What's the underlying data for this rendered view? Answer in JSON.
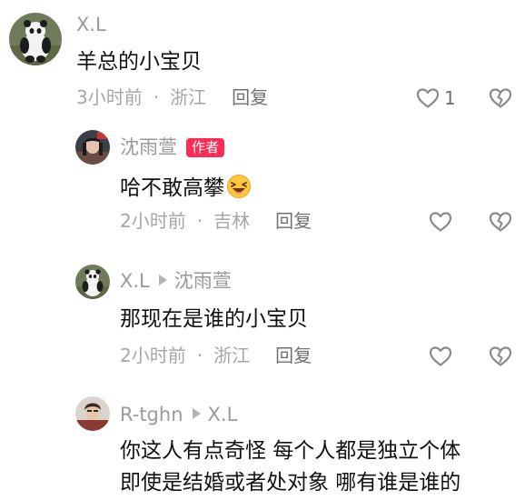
{
  "comments": [
    {
      "username": "X.L",
      "text": "羊总的小宝贝",
      "time": "3小时前",
      "location": "浙江",
      "reply_label": "回复",
      "likes": "1"
    },
    {
      "username": "沈雨萱",
      "badge": "作者",
      "text": "哈不敢高攀",
      "emoji": "grinning-squinting-emoji",
      "time": "2小时前",
      "location": "吉林",
      "reply_label": "回复"
    },
    {
      "username": "X.L",
      "reply_to": "沈雨萱",
      "text": "那现在是谁的小宝贝",
      "time": "2小时前",
      "location": "浙江",
      "reply_label": "回复"
    },
    {
      "username": "R-tghn",
      "reply_to": "X.L",
      "text_line1": "你这人有点奇怪 每个人都是独立个体",
      "text_line2": "即使是结婚或者处对象  哪有谁是谁的"
    }
  ],
  "separator": "·",
  "colors": {
    "badge": "#fe2c55",
    "username": "#9a9a9a",
    "meta": "#a6a6a6"
  }
}
